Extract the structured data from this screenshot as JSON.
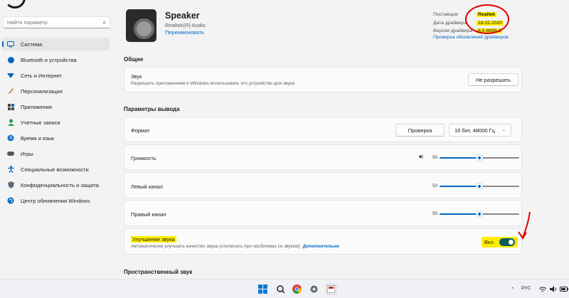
{
  "sidebar": {
    "search_placeholder": "Найти параметр",
    "items": [
      {
        "label": "Система",
        "icon": "system-icon",
        "active": true
      },
      {
        "label": "Bluetooth и устройства",
        "icon": "bluetooth-icon"
      },
      {
        "label": "Сеть и Интернет",
        "icon": "network-icon"
      },
      {
        "label": "Персонализация",
        "icon": "brush-icon"
      },
      {
        "label": "Приложения",
        "icon": "apps-icon"
      },
      {
        "label": "Учетные записи",
        "icon": "person-icon"
      },
      {
        "label": "Время и язык",
        "icon": "globe-clock-icon"
      },
      {
        "label": "Игры",
        "icon": "gamepad-icon"
      },
      {
        "label": "Специальные возможности",
        "icon": "accessibility-icon"
      },
      {
        "label": "Конфиденциальность и защита",
        "icon": "shield-icon"
      },
      {
        "label": "Центр обновления Windows",
        "icon": "update-icon"
      }
    ]
  },
  "device": {
    "name": "Speaker",
    "subtitle": "Realtek(R) Audio",
    "rename_link": "Переименовать"
  },
  "driver_info": {
    "provider_label": "Поставщик",
    "provider_value": "Realtek",
    "date_label": "Дата драйвера",
    "date_value": "18.02.2020",
    "version_label": "Версия драйвера",
    "version_value": "6.0.8899.1",
    "check_updates_link": "Проверка обновлений драйверов"
  },
  "general": {
    "section_title": "Общие",
    "sound_label": "Звук",
    "sound_desc": "Разрешить приложениям и Windows использовать это устройство для звука",
    "disallow_button": "Не разрешать"
  },
  "output": {
    "section_title": "Параметры вывода",
    "format_label": "Формат",
    "test_button": "Проверка",
    "format_value": "16 бит, 48000 Гц",
    "volume_label": "Громкость",
    "volume_value": "50",
    "volume_level": 0.5,
    "left_label": "Левый канал",
    "left_value": "50",
    "left_level": 0.5,
    "right_label": "Правый канал",
    "right_value": "50",
    "right_level": 0.5
  },
  "enhance": {
    "label": "Улучшение звука",
    "desc": "Автоматически улучшать качество звука (отключать при проблемах со звуком)",
    "more_link": "Дополнительно",
    "toggle_label": "Вкл.",
    "toggle_on": true
  },
  "spatial": {
    "section_title": "Пространственный звук"
  },
  "taskbar": {
    "icons": [
      "start-icon",
      "search-icon",
      "chrome-icon",
      "settings-icon",
      "app-icon"
    ],
    "language": "РУС"
  },
  "colors": {
    "accent": "#0067c0",
    "highlight": "#ffee00",
    "annotation": "#e00000",
    "toggle": "#0b5e57"
  }
}
